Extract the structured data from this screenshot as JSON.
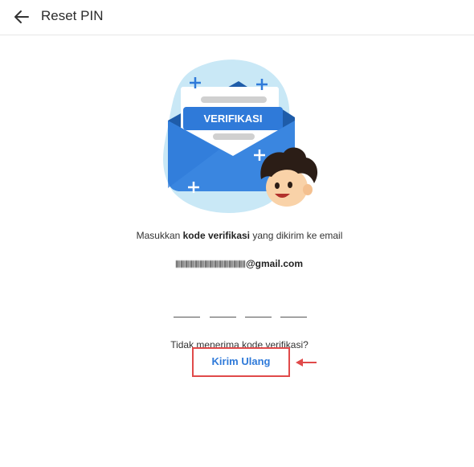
{
  "header": {
    "title": "Reset PIN",
    "back_icon": "arrow-left-icon"
  },
  "illustration": {
    "banner_text": "VERIFIKASI"
  },
  "instruction": {
    "prefix": "Masukkan ",
    "bold": "kode verifikasi",
    "suffix": " yang dikirim ke email"
  },
  "email": {
    "domain": "@gmail.com"
  },
  "otp": {
    "length": 4
  },
  "resend": {
    "question": "Tidak menerima kode verifikasi?",
    "button_label": "Kirim Ulang"
  },
  "colors": {
    "accent": "#2f7ad9",
    "highlight": "#e04a4a"
  }
}
